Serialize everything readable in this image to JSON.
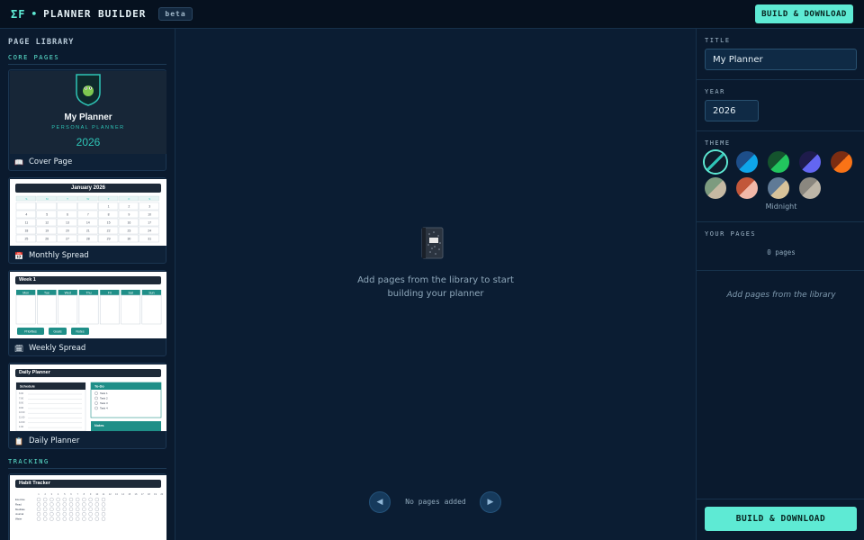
{
  "topbar": {
    "logo": "ΣF",
    "separator": "•",
    "app_name": "PLANNER BUILDER",
    "badge": "beta",
    "build_button": "BUILD & DOWNLOAD"
  },
  "library": {
    "title": "PAGE LIBRARY",
    "sections": [
      {
        "label": "CORE PAGES"
      },
      {
        "label": "TRACKING"
      }
    ],
    "cards": [
      {
        "label": "Cover Page",
        "icon": "book-icon",
        "glyph": "📖",
        "preview": {
          "title": "My Planner",
          "subtitle": "PERSONAL PLANNER",
          "year": "2026"
        }
      },
      {
        "label": "Monthly Spread",
        "icon": "calendar-icon",
        "glyph": "📅",
        "preview": {
          "title": "January 2026",
          "days": [
            "S",
            "M",
            "T",
            "W",
            "T",
            "F",
            "S"
          ],
          "dates": [
            "",
            "",
            "",
            "",
            "1",
            "2",
            "3",
            "4",
            "5",
            "6",
            "7",
            "8",
            "9",
            "10",
            "11",
            "12",
            "13",
            "14",
            "15",
            "16",
            "17",
            "18",
            "19",
            "20",
            "21",
            "22",
            "23",
            "24",
            "25",
            "26",
            "27",
            "28",
            "29",
            "30",
            "31"
          ]
        }
      },
      {
        "label": "Weekly Spread",
        "icon": "spiral-calendar-icon",
        "glyph": "🗓",
        "preview": {
          "title": "Week 1",
          "days": [
            "Mon",
            "Tue",
            "Wed",
            "Thu",
            "Fri",
            "Sat",
            "Sun"
          ],
          "tags": [
            "Priorities",
            "Goals",
            "Notes"
          ]
        }
      },
      {
        "label": "Daily Planner",
        "icon": "clipboard-icon",
        "glyph": "📋",
        "preview": {
          "title": "Daily Planner",
          "schedule": "Schedule",
          "todo": "To-Do",
          "times": [
            "6:00",
            "7:00",
            "8:00",
            "9:00",
            "10:00",
            "11:00",
            "12:00",
            "1:00"
          ],
          "tasks": [
            "Task 1",
            "Task 2",
            "Task 3",
            "Task 4"
          ],
          "notes": "Notes"
        }
      },
      {
        "preview": {
          "title": "Habit Tracker",
          "habits": [
            "Exercise",
            "Read",
            "Meditate",
            "Journal",
            "Water"
          ],
          "day_numbers": [
            "1",
            "2",
            "3",
            "4",
            "5",
            "6",
            "7",
            "8",
            "9",
            "10",
            "11",
            "12",
            "13",
            "14",
            "15",
            "16",
            "17",
            "18",
            "19",
            "20"
          ]
        }
      }
    ]
  },
  "canvas": {
    "empty_text_line1": "Add pages from the library to start",
    "empty_text_line2": "building your planner",
    "pager_text": "No pages added",
    "prev": "◀",
    "next": "▶"
  },
  "settings": {
    "title_label": "TITLE",
    "title_value": "My Planner",
    "year_label": "YEAR",
    "year_value": "2026",
    "theme_label": "THEME",
    "theme_selected": "Midnight",
    "themes": [
      {
        "a": "#0f1c2b",
        "b": "#2ec4b6"
      },
      {
        "a": "#1d4e89",
        "b": "#0ea5e9"
      },
      {
        "a": "#14532d",
        "b": "#22c55e"
      },
      {
        "a": "#1e1b4b",
        "b": "#6366f1"
      },
      {
        "a": "#7c2d12",
        "b": "#f97316"
      },
      {
        "a": "#7d9b7f",
        "b": "#c6b9a3"
      },
      {
        "a": "#c2573a",
        "b": "#f2b8a8"
      },
      {
        "a": "#5f7a96",
        "b": "#d8c39a"
      },
      {
        "a": "#8a877f",
        "b": "#bdb6a8"
      }
    ],
    "pages_label": "YOUR PAGES",
    "pages_count": "0 pages",
    "pages_hint": "Add pages from the library",
    "build_button": "BUILD & DOWNLOAD"
  }
}
